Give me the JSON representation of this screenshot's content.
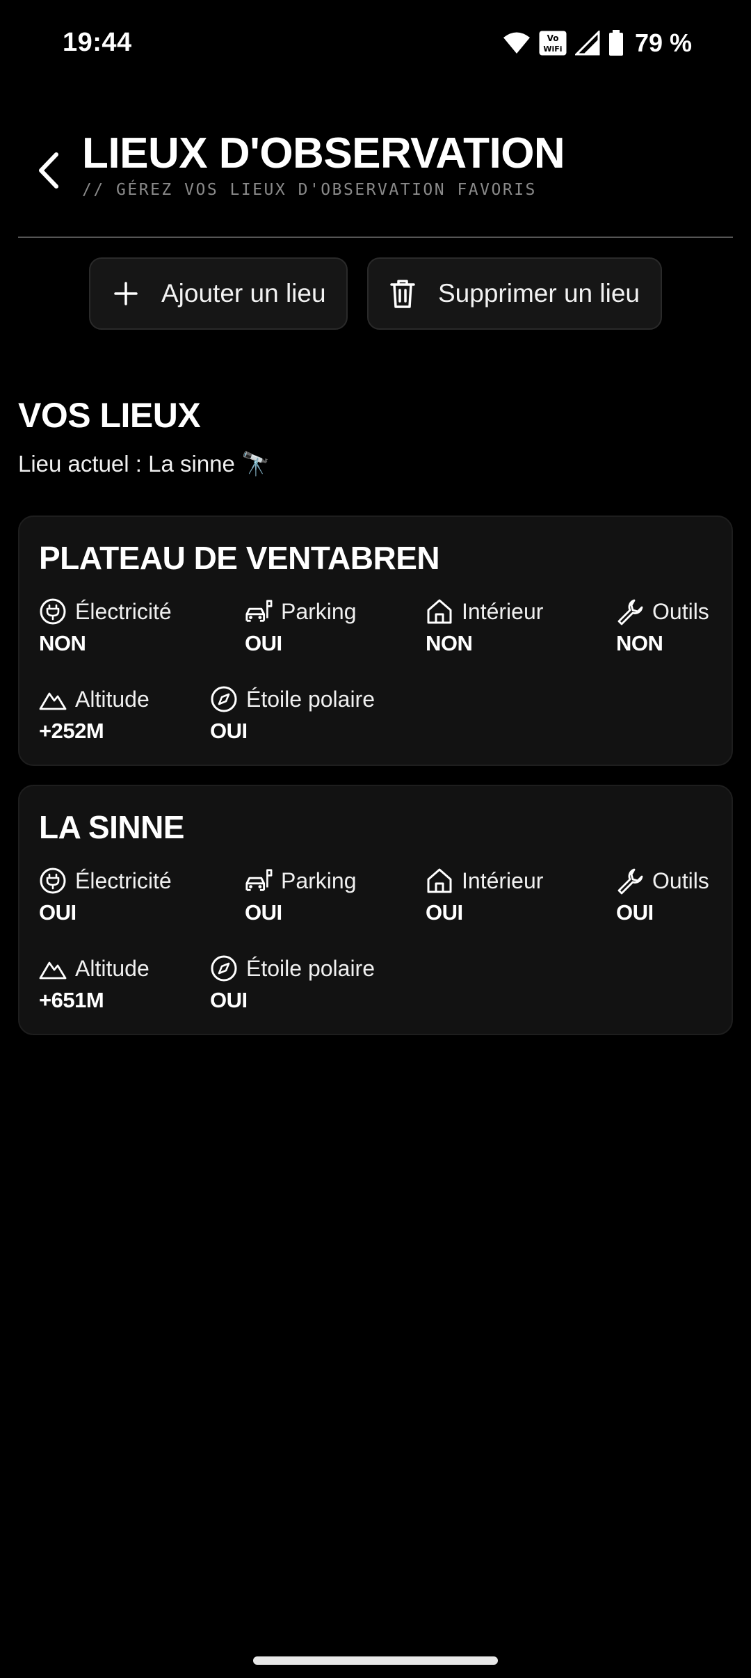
{
  "status_bar": {
    "time": "19:44",
    "vowifi": "Vo WiFi",
    "battery": "79 %",
    "icons": [
      "wifi-icon",
      "vowifi-icon",
      "signal-icon",
      "battery-icon"
    ]
  },
  "header": {
    "title": "LIEUX D'OBSERVATION",
    "subtitle": "// GÉREZ VOS LIEUX D'OBSERVATION FAVORIS",
    "back_icon": "chevron-left-icon"
  },
  "actions": {
    "add_label": "Ajouter un lieu",
    "add_icon": "plus-icon",
    "delete_label": "Supprimer un lieu",
    "delete_icon": "trash-icon"
  },
  "section": {
    "title": "VOS LIEUX",
    "current_location": "Lieu actuel : La sinne 🔭"
  },
  "locations": [
    {
      "name": "PLATEAU DE VENTABREN",
      "electricity": {
        "label": "Électricité",
        "value": "NON"
      },
      "parking": {
        "label": "Parking",
        "value": "OUI"
      },
      "interior": {
        "label": "Intérieur",
        "value": "NON"
      },
      "tools": {
        "label": "Outils",
        "value": "NON"
      },
      "altitude": {
        "label": "Altitude",
        "value": "+252M"
      },
      "polaris": {
        "label": "Étoile polaire",
        "value": "OUI"
      }
    },
    {
      "name": "LA SINNE",
      "electricity": {
        "label": "Électricité",
        "value": "OUI"
      },
      "parking": {
        "label": "Parking",
        "value": "OUI"
      },
      "interior": {
        "label": "Intérieur",
        "value": "OUI"
      },
      "tools": {
        "label": "Outils",
        "value": "OUI"
      },
      "altitude": {
        "label": "Altitude",
        "value": "+651M"
      },
      "polaris": {
        "label": "Étoile polaire",
        "value": "OUI"
      }
    }
  ],
  "colors": {
    "background": "#000000",
    "card": "#121212",
    "button": "#161616",
    "subtitle": "#8a8a8a",
    "text": "#ffffff"
  }
}
